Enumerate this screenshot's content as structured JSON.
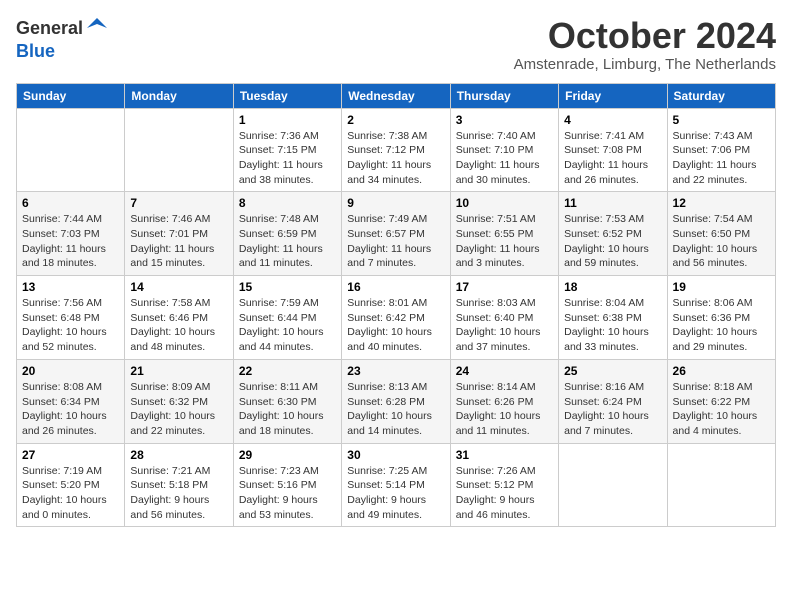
{
  "header": {
    "logo_line1": "General",
    "logo_line2": "Blue",
    "month": "October 2024",
    "location": "Amstenrade, Limburg, The Netherlands"
  },
  "days_of_week": [
    "Sunday",
    "Monday",
    "Tuesday",
    "Wednesday",
    "Thursday",
    "Friday",
    "Saturday"
  ],
  "weeks": [
    [
      {
        "num": "",
        "detail": ""
      },
      {
        "num": "",
        "detail": ""
      },
      {
        "num": "1",
        "detail": "Sunrise: 7:36 AM\nSunset: 7:15 PM\nDaylight: 11 hours and 38 minutes."
      },
      {
        "num": "2",
        "detail": "Sunrise: 7:38 AM\nSunset: 7:12 PM\nDaylight: 11 hours and 34 minutes."
      },
      {
        "num": "3",
        "detail": "Sunrise: 7:40 AM\nSunset: 7:10 PM\nDaylight: 11 hours and 30 minutes."
      },
      {
        "num": "4",
        "detail": "Sunrise: 7:41 AM\nSunset: 7:08 PM\nDaylight: 11 hours and 26 minutes."
      },
      {
        "num": "5",
        "detail": "Sunrise: 7:43 AM\nSunset: 7:06 PM\nDaylight: 11 hours and 22 minutes."
      }
    ],
    [
      {
        "num": "6",
        "detail": "Sunrise: 7:44 AM\nSunset: 7:03 PM\nDaylight: 11 hours and 18 minutes."
      },
      {
        "num": "7",
        "detail": "Sunrise: 7:46 AM\nSunset: 7:01 PM\nDaylight: 11 hours and 15 minutes."
      },
      {
        "num": "8",
        "detail": "Sunrise: 7:48 AM\nSunset: 6:59 PM\nDaylight: 11 hours and 11 minutes."
      },
      {
        "num": "9",
        "detail": "Sunrise: 7:49 AM\nSunset: 6:57 PM\nDaylight: 11 hours and 7 minutes."
      },
      {
        "num": "10",
        "detail": "Sunrise: 7:51 AM\nSunset: 6:55 PM\nDaylight: 11 hours and 3 minutes."
      },
      {
        "num": "11",
        "detail": "Sunrise: 7:53 AM\nSunset: 6:52 PM\nDaylight: 10 hours and 59 minutes."
      },
      {
        "num": "12",
        "detail": "Sunrise: 7:54 AM\nSunset: 6:50 PM\nDaylight: 10 hours and 56 minutes."
      }
    ],
    [
      {
        "num": "13",
        "detail": "Sunrise: 7:56 AM\nSunset: 6:48 PM\nDaylight: 10 hours and 52 minutes."
      },
      {
        "num": "14",
        "detail": "Sunrise: 7:58 AM\nSunset: 6:46 PM\nDaylight: 10 hours and 48 minutes."
      },
      {
        "num": "15",
        "detail": "Sunrise: 7:59 AM\nSunset: 6:44 PM\nDaylight: 10 hours and 44 minutes."
      },
      {
        "num": "16",
        "detail": "Sunrise: 8:01 AM\nSunset: 6:42 PM\nDaylight: 10 hours and 40 minutes."
      },
      {
        "num": "17",
        "detail": "Sunrise: 8:03 AM\nSunset: 6:40 PM\nDaylight: 10 hours and 37 minutes."
      },
      {
        "num": "18",
        "detail": "Sunrise: 8:04 AM\nSunset: 6:38 PM\nDaylight: 10 hours and 33 minutes."
      },
      {
        "num": "19",
        "detail": "Sunrise: 8:06 AM\nSunset: 6:36 PM\nDaylight: 10 hours and 29 minutes."
      }
    ],
    [
      {
        "num": "20",
        "detail": "Sunrise: 8:08 AM\nSunset: 6:34 PM\nDaylight: 10 hours and 26 minutes."
      },
      {
        "num": "21",
        "detail": "Sunrise: 8:09 AM\nSunset: 6:32 PM\nDaylight: 10 hours and 22 minutes."
      },
      {
        "num": "22",
        "detail": "Sunrise: 8:11 AM\nSunset: 6:30 PM\nDaylight: 10 hours and 18 minutes."
      },
      {
        "num": "23",
        "detail": "Sunrise: 8:13 AM\nSunset: 6:28 PM\nDaylight: 10 hours and 14 minutes."
      },
      {
        "num": "24",
        "detail": "Sunrise: 8:14 AM\nSunset: 6:26 PM\nDaylight: 10 hours and 11 minutes."
      },
      {
        "num": "25",
        "detail": "Sunrise: 8:16 AM\nSunset: 6:24 PM\nDaylight: 10 hours and 7 minutes."
      },
      {
        "num": "26",
        "detail": "Sunrise: 8:18 AM\nSunset: 6:22 PM\nDaylight: 10 hours and 4 minutes."
      }
    ],
    [
      {
        "num": "27",
        "detail": "Sunrise: 7:19 AM\nSunset: 5:20 PM\nDaylight: 10 hours and 0 minutes."
      },
      {
        "num": "28",
        "detail": "Sunrise: 7:21 AM\nSunset: 5:18 PM\nDaylight: 9 hours and 56 minutes."
      },
      {
        "num": "29",
        "detail": "Sunrise: 7:23 AM\nSunset: 5:16 PM\nDaylight: 9 hours and 53 minutes."
      },
      {
        "num": "30",
        "detail": "Sunrise: 7:25 AM\nSunset: 5:14 PM\nDaylight: 9 hours and 49 minutes."
      },
      {
        "num": "31",
        "detail": "Sunrise: 7:26 AM\nSunset: 5:12 PM\nDaylight: 9 hours and 46 minutes."
      },
      {
        "num": "",
        "detail": ""
      },
      {
        "num": "",
        "detail": ""
      }
    ]
  ]
}
